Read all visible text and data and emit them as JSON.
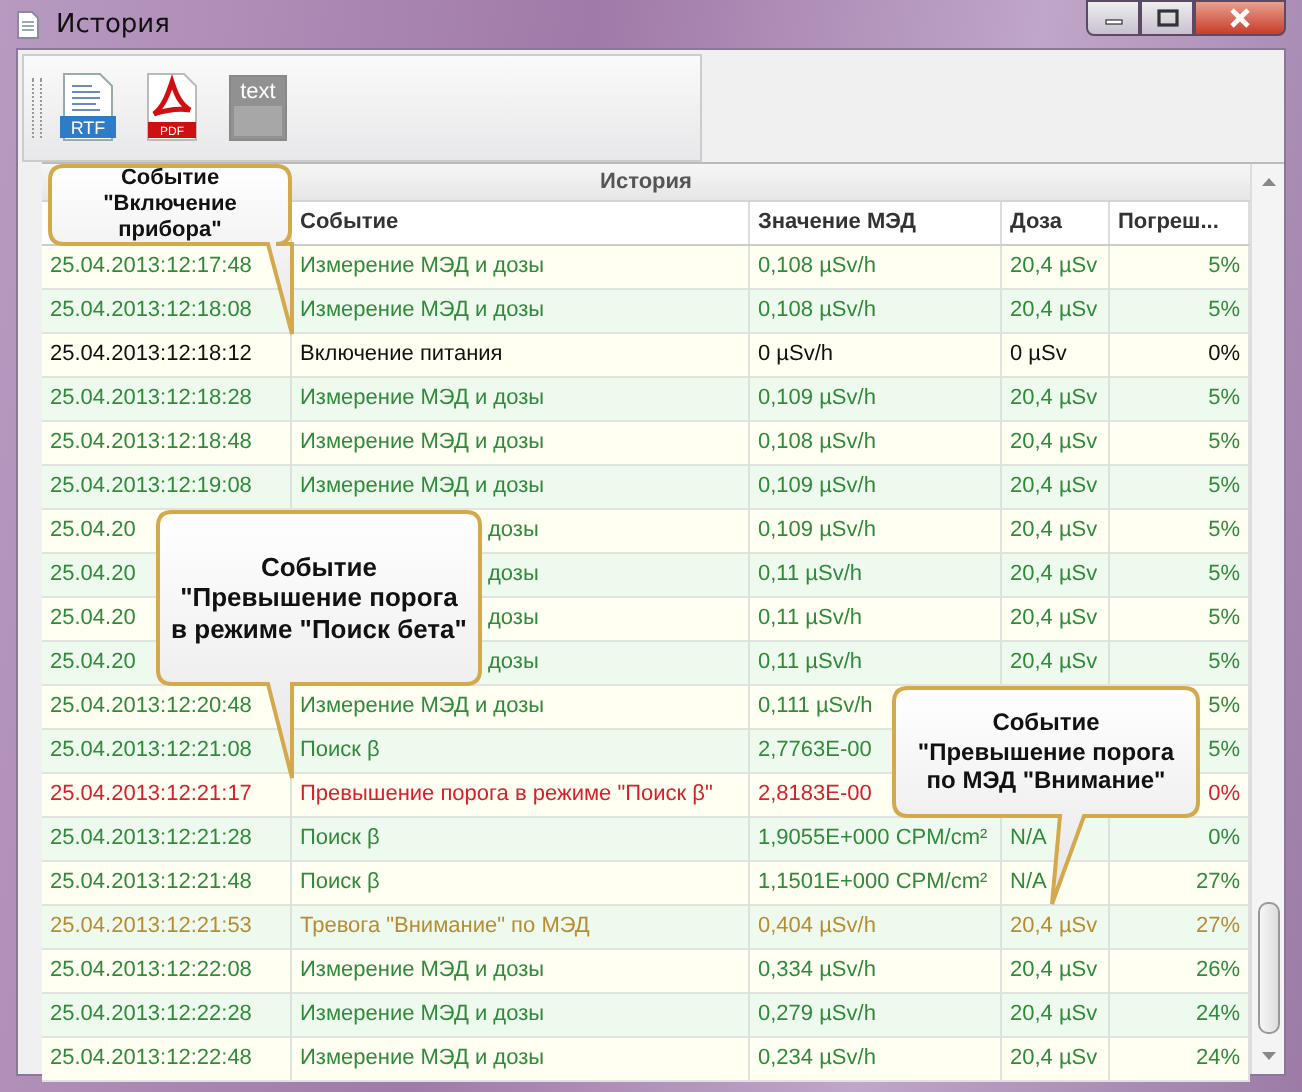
{
  "window": {
    "title": "История"
  },
  "toolbar": [
    {
      "label": "RTF",
      "kind": "rtf",
      "disabled": false
    },
    {
      "label": "PDF",
      "kind": "pdf",
      "disabled": false
    },
    {
      "label": "text",
      "kind": "text",
      "disabled": true
    }
  ],
  "table": {
    "title": "История",
    "columns": [
      "",
      "Событие",
      "Значение МЭД",
      "Доза",
      "Погреш..."
    ],
    "rows": [
      {
        "kind": "measurement",
        "cells": [
          "25.04.2013:12:17:48",
          "Измерение МЭД и дозы",
          "0,108 µSv/h",
          "20,4 µSv",
          "5%"
        ]
      },
      {
        "kind": "measurement",
        "cells": [
          "25.04.2013:12:18:08",
          "Измерение МЭД и дозы",
          "0,108 µSv/h",
          "20,4 µSv",
          "5%"
        ]
      },
      {
        "kind": "power",
        "cells": [
          "25.04.2013:12:18:12",
          "Включение питания",
          "0 µSv/h",
          "0 µSv",
          "0%"
        ]
      },
      {
        "kind": "measurement",
        "cells": [
          "25.04.2013:12:18:28",
          "Измерение МЭД и дозы",
          "0,109 µSv/h",
          "20,4 µSv",
          "5%"
        ]
      },
      {
        "kind": "measurement",
        "cells": [
          "25.04.2013:12:18:48",
          "Измерение МЭД и дозы",
          "0,108 µSv/h",
          "20,4 µSv",
          "5%"
        ]
      },
      {
        "kind": "measurement",
        "cells": [
          "25.04.2013:12:19:08",
          "Измерение МЭД и дозы",
          "0,109 µSv/h",
          "20,4 µSv",
          "5%"
        ]
      },
      {
        "kind": "measurement",
        "cells": [
          "25.04.20",
          {
            "text": "дозы",
            "clipped_start": true
          },
          "0,109 µSv/h",
          "20,4 µSv",
          "5%"
        ]
      },
      {
        "kind": "measurement",
        "cells": [
          "25.04.20",
          {
            "text": "дозы",
            "clipped_start": true
          },
          "0,11 µSv/h",
          "20,4 µSv",
          "5%"
        ]
      },
      {
        "kind": "measurement",
        "cells": [
          "25.04.20",
          {
            "text": "дозы",
            "clipped_start": true
          },
          "0,11 µSv/h",
          "20,4 µSv",
          "5%"
        ]
      },
      {
        "kind": "measurement",
        "cells": [
          "25.04.20",
          {
            "text": "дозы",
            "clipped_start": true
          },
          "0,11 µSv/h",
          "20,4 µSv",
          "5%"
        ]
      },
      {
        "kind": "measurement",
        "cells": [
          "25.04.2013:12:20:48",
          "Измерение МЭД и дозы",
          "0,111 µSv/h",
          null,
          "5%"
        ]
      },
      {
        "kind": "measurement",
        "cells": [
          "25.04.2013:12:21:08",
          "Поиск β",
          "2,7763E-00",
          null,
          "5%"
        ]
      },
      {
        "kind": "threshold",
        "cells": [
          "25.04.2013:12:21:17",
          "Превышение порога в режиме \"Поиск β\"",
          "2,8183E-00",
          null,
          "0%"
        ]
      },
      {
        "kind": "measurement",
        "cells": [
          "25.04.2013:12:21:28",
          "Поиск β",
          "1,9055E+000 CPM/cm²",
          "N/A",
          "0%"
        ]
      },
      {
        "kind": "measurement",
        "cells": [
          "25.04.2013:12:21:48",
          "Поиск β",
          "1,1501E+000 CPM/cm²",
          "N/A",
          "27%"
        ]
      },
      {
        "kind": "alarm",
        "cells": [
          "25.04.2013:12:21:53",
          "Тревога \"Внимание\" по МЭД",
          "0,404 µSv/h",
          "20,4 µSv",
          "27%"
        ]
      },
      {
        "kind": "measurement",
        "cells": [
          "25.04.2013:12:22:08",
          "Измерение МЭД и дозы",
          "0,334 µSv/h",
          "20,4 µSv",
          "26%"
        ]
      },
      {
        "kind": "measurement",
        "cells": [
          "25.04.2013:12:22:28",
          "Измерение МЭД и дозы",
          "0,279 µSv/h",
          "20,4 µSv",
          "24%"
        ]
      },
      {
        "kind": "measurement",
        "cells": [
          "25.04.2013:12:22:48",
          "Измерение МЭД и дозы",
          "0,234 µSv/h",
          "20,4 µSv",
          "24%"
        ]
      }
    ]
  },
  "callouts": [
    {
      "text": "Событие \"Включение\nприбора\""
    },
    {
      "text": "Событие\n\"Превышение порога\nв режиме \"Поиск бета\""
    },
    {
      "text": "Событие\n\"Превышение порога\nпо МЭД \"Внимание\""
    }
  ]
}
